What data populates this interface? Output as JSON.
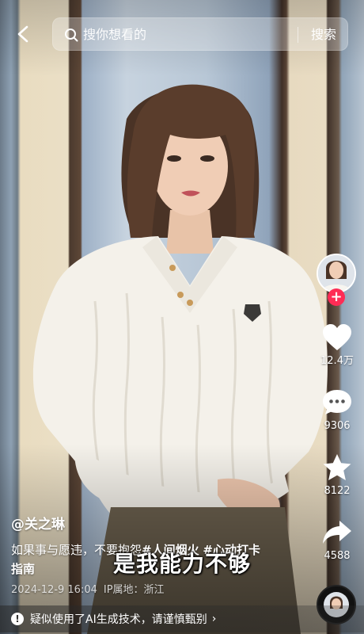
{
  "search": {
    "placeholder": "搜你想看的",
    "button_label": "搜索"
  },
  "rail": {
    "likes": "12.4万",
    "comments": "9306",
    "favorites": "8122",
    "shares": "4588",
    "follow_symbol": "+"
  },
  "video": {
    "author": "@关之琳",
    "description_text": "如果事与愿违，不要抱怨",
    "hashtags": [
      "#人间烟火",
      "#心动打卡指南"
    ],
    "date": "2024-12-9 16:04",
    "location": "IP属地：浙江",
    "subtitle": "是我能力不够"
  },
  "notice": {
    "ai_text": "疑似使用了AI生成技术，请谨慎甄别",
    "warn_symbol": "!",
    "chevron": "›"
  },
  "colors": {
    "accent_red": "#fe2c55",
    "heart": "#ffffff",
    "star": "#ffffff"
  }
}
